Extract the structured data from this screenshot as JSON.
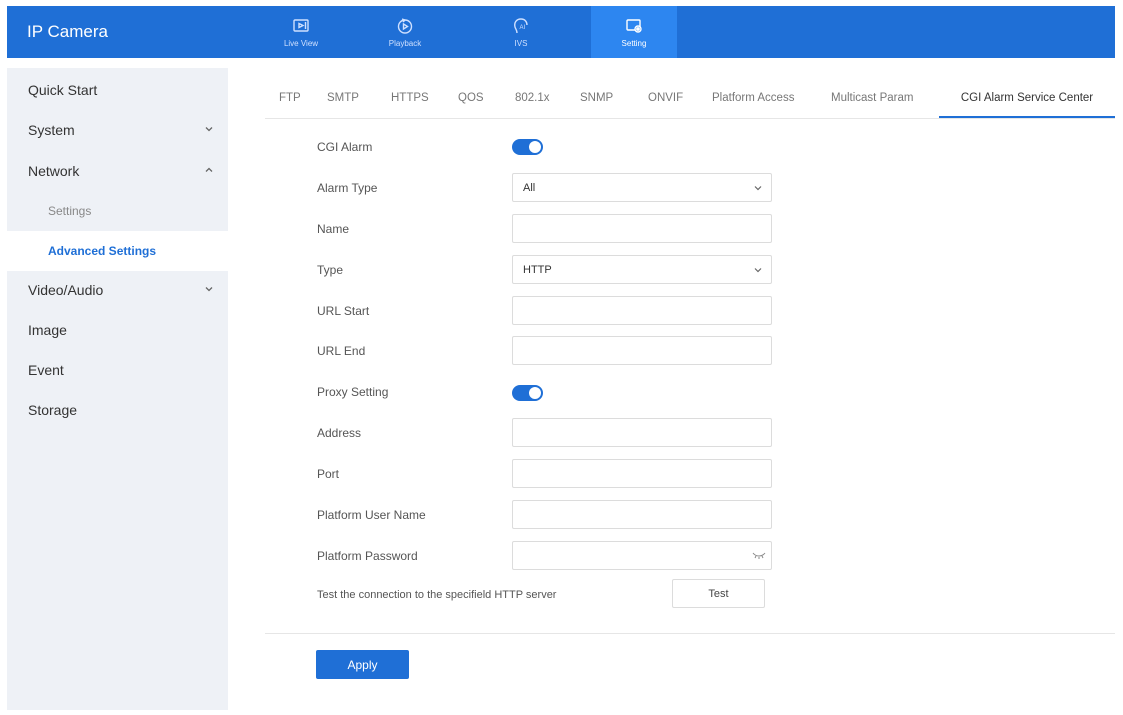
{
  "app": {
    "title": "IP Camera"
  },
  "topnav": [
    {
      "label": "Live View",
      "icon": "live-view-icon"
    },
    {
      "label": "Playback",
      "icon": "playback-icon"
    },
    {
      "label": "IVS",
      "icon": "ivs-icon"
    },
    {
      "label": "Setting",
      "icon": "setting-icon",
      "active": true
    }
  ],
  "sidebar": {
    "items": [
      {
        "label": "Quick Start"
      },
      {
        "label": "System"
      },
      {
        "label": "Network",
        "expanded": true
      },
      {
        "label": "Settings"
      },
      {
        "label": "Advanced Settings",
        "active": true
      },
      {
        "label": "Video/Audio"
      },
      {
        "label": "Image"
      },
      {
        "label": "Event"
      },
      {
        "label": "Storage"
      }
    ]
  },
  "tabs": [
    {
      "label": "FTP"
    },
    {
      "label": "SMTP"
    },
    {
      "label": "HTTPS"
    },
    {
      "label": "QOS"
    },
    {
      "label": "802.1x"
    },
    {
      "label": "SNMP"
    },
    {
      "label": "ONVIF"
    },
    {
      "label": "Platform Access"
    },
    {
      "label": "Multicast Param"
    },
    {
      "label": "CGI Alarm Service Center",
      "active": true
    }
  ],
  "form": {
    "cgi_alarm": {
      "label": "CGI Alarm",
      "enabled": true
    },
    "alarm_type": {
      "label": "Alarm Type",
      "value": "All"
    },
    "name": {
      "label": "Name",
      "value": ""
    },
    "type": {
      "label": "Type",
      "value": "HTTP"
    },
    "url_start": {
      "label": "URL Start",
      "value": ""
    },
    "url_end": {
      "label": "URL End",
      "value": ""
    },
    "proxy_setting": {
      "label": "Proxy Setting",
      "enabled": true
    },
    "address": {
      "label": "Address",
      "value": ""
    },
    "port": {
      "label": "Port",
      "value": ""
    },
    "platform_user_name": {
      "label": "Platform User Name",
      "value": ""
    },
    "platform_password": {
      "label": "Platform Password",
      "value": ""
    },
    "test": {
      "label": "Test the connection to the specifield HTTP server",
      "button": "Test"
    }
  },
  "apply_label": "Apply",
  "colors": {
    "accent": "#1f6fd6",
    "active_nav": "#2d86f0",
    "sidebar_bg": "#eef1f6"
  }
}
